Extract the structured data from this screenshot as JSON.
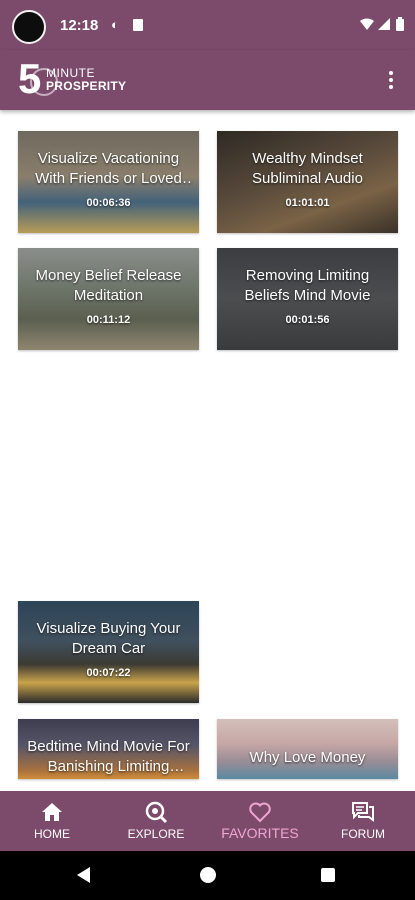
{
  "status_bar": {
    "time": "12:18",
    "icons": [
      "camera-punch-hole",
      "sync-icon",
      "sd-card-icon",
      "wifi-icon",
      "cell-signal-icon",
      "battery-icon"
    ]
  },
  "app_bar": {
    "logo_number": "5",
    "logo_top": "MINUTE",
    "logo_bottom": "PROSPERITY",
    "overflow_menu_icon": "more-vert-icon"
  },
  "videos": [
    {
      "title": "Visualize Vacationing With Friends or Loved Ones",
      "duration": "00:06:36"
    },
    {
      "title": "Wealthy Mindset Subliminal Audio",
      "duration": "01:01:01"
    },
    {
      "title": "Money Belief Release Meditation",
      "duration": "00:11:12"
    },
    {
      "title": "Removing Limiting Beliefs Mind Movie",
      "duration": "00:01:56"
    },
    {
      "title": "Visualize Buying Your Dream Car",
      "duration": "00:07:22"
    },
    {
      "title": "Bedtime Mind Movie For Banishing Limiting Beliefs",
      "duration": ""
    },
    {
      "title": "Why Love Money",
      "duration": ""
    }
  ],
  "bottom_nav": {
    "items": [
      {
        "label": "HOME",
        "icon": "home-icon"
      },
      {
        "label": "EXPLORE",
        "icon": "explore-search-icon"
      },
      {
        "label": "FAVORITES",
        "icon": "heart-icon"
      },
      {
        "label": "FORUM",
        "icon": "forum-icon"
      }
    ],
    "active": "FAVORITES"
  },
  "colors": {
    "brand": "#7c4a6a",
    "active_nav": "#f0a6d4",
    "text_on_brand": "#ffffff"
  }
}
